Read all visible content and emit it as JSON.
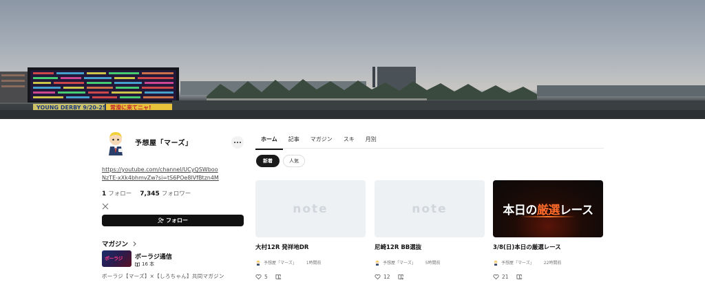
{
  "profile": {
    "name": "予想屋「マーズ」",
    "link": "https://youtube.com/channel/UCyQSWbooNzTE-xXk4bhmvZw?si=tS6POe8lVfBtzn4M",
    "following_count": "1",
    "following_label": "フォロー",
    "followers_count": "7,345",
    "followers_label": "フォロワー",
    "follow_button_label": "フォロー"
  },
  "magazine": {
    "heading": "マガジン",
    "title": "ボーラジ通信",
    "count": "16 本",
    "thumb_text": "ボーラジ",
    "description": "ボーラジ【マーズ】×【しろちゃん】共同マガジン"
  },
  "tabs": [
    "ホーム",
    "記事",
    "マガジン",
    "スキ",
    "月別"
  ],
  "active_tab": "ホーム",
  "chips": {
    "new": "新着",
    "popular": "人気"
  },
  "cards": [
    {
      "title": "大村12R 発祥地DR",
      "author": "予想屋「マーズ」",
      "time": "1時間前",
      "likes": "5",
      "thumb": "note"
    },
    {
      "title": "尼崎12R BB選抜",
      "author": "予想屋「マーズ」",
      "time": "5時間前",
      "likes": "12",
      "thumb": "note"
    },
    {
      "title": "3/8(日)本日の厳選レース",
      "author": "予想屋「マーズ」",
      "time": "22時間前",
      "likes": "21",
      "thumb": "image",
      "thumb_text_plain": "本日の",
      "thumb_text_accent": "厳選",
      "thumb_text_tail": "レース"
    }
  ],
  "note_logo_text": "note",
  "banner": {
    "sign_text_1": "YOUNG DERBY 9/20-25",
    "sign_text_2": "常滑に来てニャ!"
  },
  "colors": {
    "primary": "#111111",
    "accent": "#ff6a2a"
  }
}
